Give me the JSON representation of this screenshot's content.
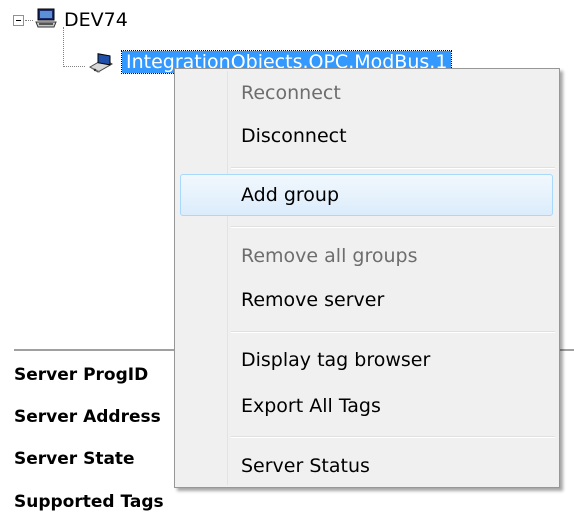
{
  "tree": {
    "root_label": "DEV74",
    "server_label": "IntegrationObjects.OPC.ModBus.1"
  },
  "properties": {
    "labels": [
      "Server ProgID",
      "Server Address",
      "Server State",
      "Supported Tags"
    ]
  },
  "context_menu": {
    "items": [
      {
        "label": "Reconnect",
        "disabled": true
      },
      {
        "label": "Disconnect",
        "disabled": false
      },
      {
        "label": "Add group",
        "disabled": false,
        "hovered": true
      },
      {
        "label": "Remove all groups",
        "disabled": true
      },
      {
        "label": "Remove server",
        "disabled": false
      },
      {
        "label": "Display tag browser",
        "disabled": false
      },
      {
        "label": "Export All Tags",
        "disabled": false
      },
      {
        "label": "Server Status",
        "disabled": false
      }
    ]
  },
  "colors": {
    "selection": "#3399ff",
    "menu_background": "#f0f0f0",
    "hover_border": "#a8d8fb",
    "disabled_text": "#6d6d6d"
  }
}
